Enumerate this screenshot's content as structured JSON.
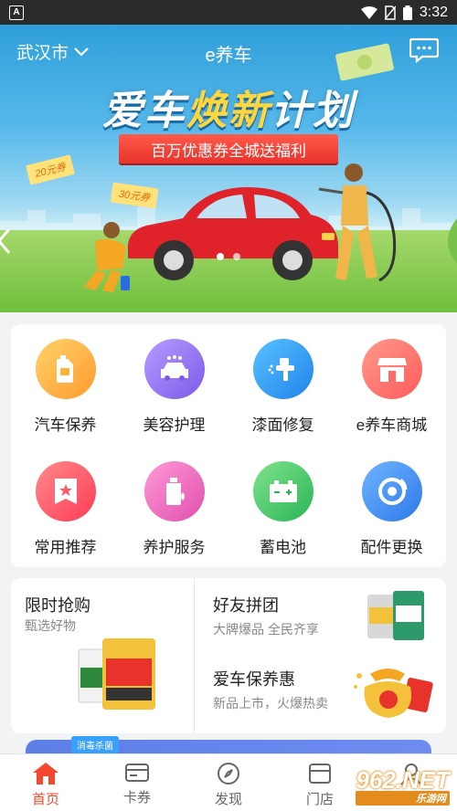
{
  "status_bar": {
    "time": "3:32",
    "app_badge": "A"
  },
  "header": {
    "city": "武汉市",
    "title": "e养车"
  },
  "banner": {
    "headline_part1": "爱车",
    "headline_part2": "焕新",
    "headline_part3": "计划",
    "ribbon": "百万优惠券全城送福利",
    "coupon_a": "20元券",
    "coupon_b": "30元券"
  },
  "services": [
    {
      "label": "汽车保养",
      "icon": "engine-oil-icon",
      "color": "#ffb23a"
    },
    {
      "label": "美容护理",
      "icon": "car-wash-icon",
      "color": "#8b6cf0"
    },
    {
      "label": "漆面修复",
      "icon": "spray-gun-icon",
      "color": "#2d9bf0"
    },
    {
      "label": "e养车商城",
      "icon": "store-icon",
      "color": "#ff6b6b"
    },
    {
      "label": "常用推荐",
      "icon": "bookmark-star-icon",
      "color": "#ff5a68"
    },
    {
      "label": "养护服务",
      "icon": "fluid-bottle-icon",
      "color": "#f06bc0"
    },
    {
      "label": "蓄电池",
      "icon": "battery-icon",
      "color": "#3cc46a"
    },
    {
      "label": "配件更换",
      "icon": "brake-disc-icon",
      "color": "#3a8cf3"
    }
  ],
  "promos": {
    "flash_sale": {
      "title": "限时抢购",
      "subtitle": "甄选好物"
    },
    "group_buy": {
      "title": "好友拼团",
      "subtitle": "大牌爆品 全民齐享"
    },
    "maintenance_deal": {
      "title": "爱车保养惠",
      "subtitle": "新品上市，火爆热卖"
    }
  },
  "peek_tag": "消毒杀菌",
  "tabs": [
    {
      "label": "首页",
      "icon": "home-icon",
      "active": true
    },
    {
      "label": "卡券",
      "icon": "card-icon",
      "active": false
    },
    {
      "label": "发现",
      "icon": "compass-icon",
      "active": false
    },
    {
      "label": "门店",
      "icon": "store-icon",
      "active": false
    },
    {
      "label": "我的",
      "icon": "user-icon",
      "active": false
    }
  ],
  "watermark": {
    "main": "962.NET",
    "sub": "乐游网"
  }
}
